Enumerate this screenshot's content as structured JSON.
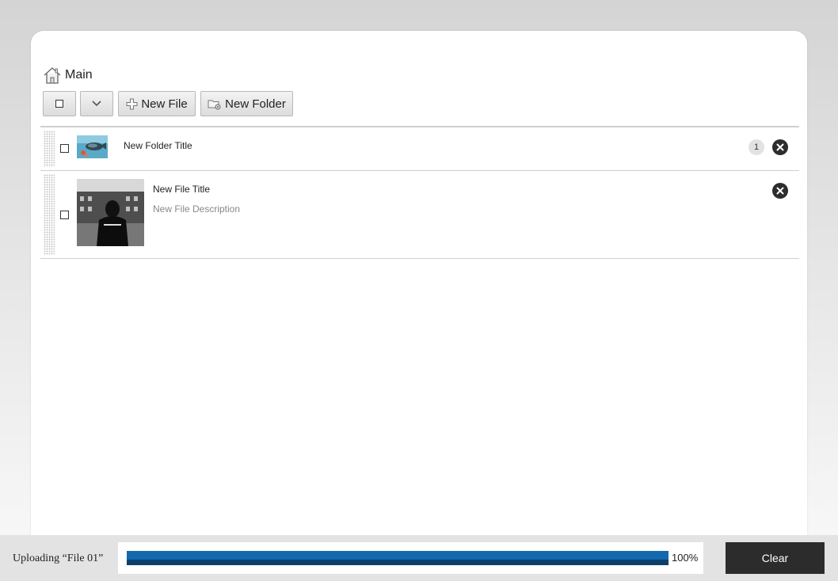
{
  "breadcrumb": {
    "label": "Main",
    "icon": "home-icon"
  },
  "toolbar": {
    "select_all_icon": "checkbox-icon",
    "dropdown_icon": "chevron-down-icon",
    "new_file_label": "New File",
    "new_file_icon": "plus-icon",
    "new_folder_label": "New Folder",
    "new_folder_icon": "folder-gear-icon"
  },
  "items": [
    {
      "type": "folder",
      "title": "New Folder Title",
      "count": "1",
      "thumbnail": "fish-photo"
    },
    {
      "type": "file",
      "title": "New File Title",
      "description": "New File Description",
      "thumbnail": "person-building-photo"
    }
  ],
  "upload": {
    "status_text": "Uploading “File 01”",
    "progress": 1.0,
    "progress_label": "100%",
    "clear_label": "Clear"
  },
  "colors": {
    "progress": "#1468ad",
    "clear_button": "#2c2c2c",
    "delete_button": "#2d2d2d"
  }
}
